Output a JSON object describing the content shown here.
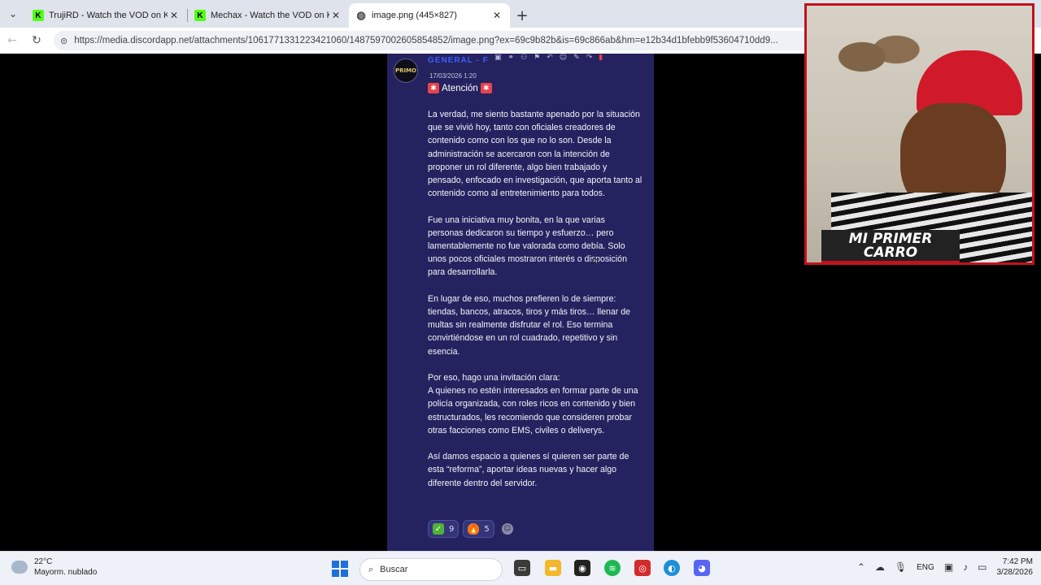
{
  "browser": {
    "tabs": [
      {
        "title": "TrujiRD - Watch the VOD on Kick",
        "favicon": "kick-icon",
        "active": false
      },
      {
        "title": "Mechax - Watch the VOD on Kick",
        "favicon": "kick-icon",
        "active": false
      },
      {
        "title": "image.png (445×827)",
        "favicon": "globe-icon",
        "active": true
      }
    ],
    "new_tab_label": "+",
    "url": "https://media.discordapp.net/attachments/1061771331223421060/1487597002605854852/image.png?ex=69c9b82b&is=69c866ab&hm=e12b34d1bfebb9f53604710dd9..."
  },
  "discord_message": {
    "author": "GENERAL - F",
    "avatar_text": "PRIMO",
    "timestamp": "17/03/2026 1:20",
    "headline": "Atención",
    "paragraphs": [
      "La verdad, me siento bastante apenado por la situación que se vivió hoy, tanto con oficiales creadores de contenido como con los que no lo son. Desde la administración se acercaron con la intención de proponer un rol diferente, algo bien trabajado y pensado, enfocado en investigación, que aporta tanto al contenido como al entretenimiento para todos.",
      "Fue una iniciativa muy bonita, en la que varias personas dedicaron su tiempo y esfuerzo… pero lamentablemente no fue valorada como debía. Solo unos pocos oficiales mostraron interés o disposición para desarrollarla.",
      "En lugar de eso, muchos prefieren lo de siempre: tiendas, bancos, atracos, tiros y más tiros… llenar de multas sin realmente disfrutar el rol. Eso termina convirtiéndose en un rol cuadrado, repetitivo y sin esencia.",
      "Por eso, hago una invitación clara:",
      "A quienes no estén interesados en formar parte de una policía organizada, con roles ricos en contenido y bien estructurados, les recomiendo que consideren probar otras facciones como EMS, civiles o deliverys.",
      "Así damos espacio a quienes sí quieren ser parte de esta “reforma”, aportar ideas nuevas y hacer algo diferente dentro del servidor."
    ],
    "reactions": [
      {
        "emoji": "✓",
        "count": "9"
      },
      {
        "emoji": "🔥",
        "count": "5"
      }
    ]
  },
  "webcam": {
    "banner": "MI PRIMER CARRO"
  },
  "taskbar": {
    "weather_temp": "22°C",
    "weather_desc": "Mayorm. nublado",
    "search_placeholder": "Buscar",
    "language": "ENG",
    "time": "7:42 PM",
    "date": "3/28/2026"
  },
  "colors": {
    "discord_bg": "#25235f",
    "accent_red": "#c2121c",
    "kick_green": "#53fc18"
  }
}
